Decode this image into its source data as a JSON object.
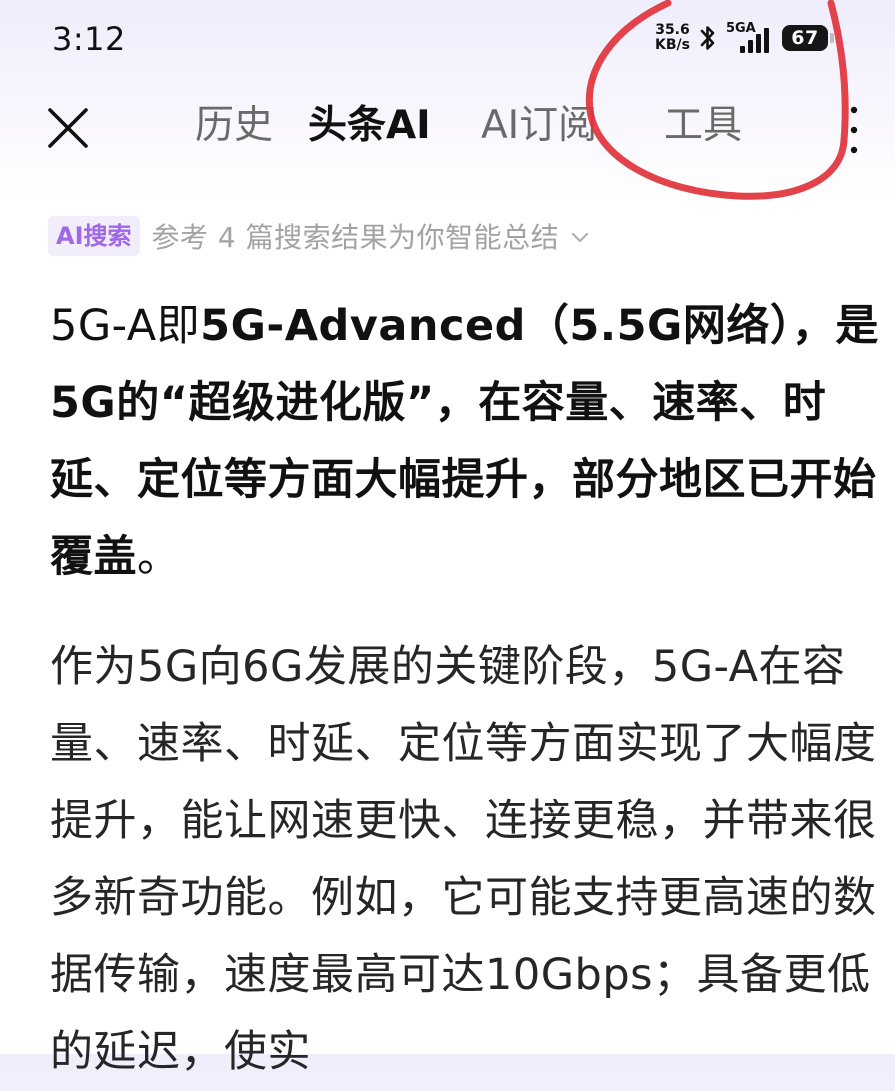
{
  "status_bar": {
    "time": "3:12",
    "net_speed_value": "35.6",
    "net_speed_unit": "KB/s",
    "signal_label": "5GA",
    "battery": "67",
    "icons": [
      "bluetooth-icon",
      "signal-icon",
      "battery-icon"
    ]
  },
  "nav": {
    "close_icon": "close-icon",
    "tabs": [
      {
        "label": "历史",
        "active": false
      },
      {
        "label": "头条AI",
        "active": true
      },
      {
        "label": "AI订阅",
        "active": false
      },
      {
        "label": "工具",
        "active": false
      }
    ],
    "more_icon": "more-vertical-icon"
  },
  "ai_summary": {
    "badge": "AI搜索",
    "text": "参考 4 篇搜索结果为你智能总结",
    "expand_icon": "chevron-down-icon"
  },
  "answer": {
    "lead_prefix": "5G-A即",
    "lead_bold": "5G-Advanced（5.5G网络），是5G的“超级进化版”，在容量、速率、时延、定位等方面大幅提升，部分地区已开始覆盖",
    "lead_suffix": "。",
    "body": "作为5G向6G发展的关键阶段，5G-A在容量、速率、时延、定位等方面实现了大幅度提升，能让网速更快、连接更稳，并带来很多新奇功能。例如，它可能支持更高速的数据传输，速度最高可达10Gbps；具备更低的延迟，使实"
  },
  "colors": {
    "annotation_stroke": "#e0333c",
    "ai_badge_text": "#a067e6",
    "ai_badge_bg": "#f1edfb",
    "active_tab": "#111111",
    "inactive_tab": "#6a6a6a"
  }
}
